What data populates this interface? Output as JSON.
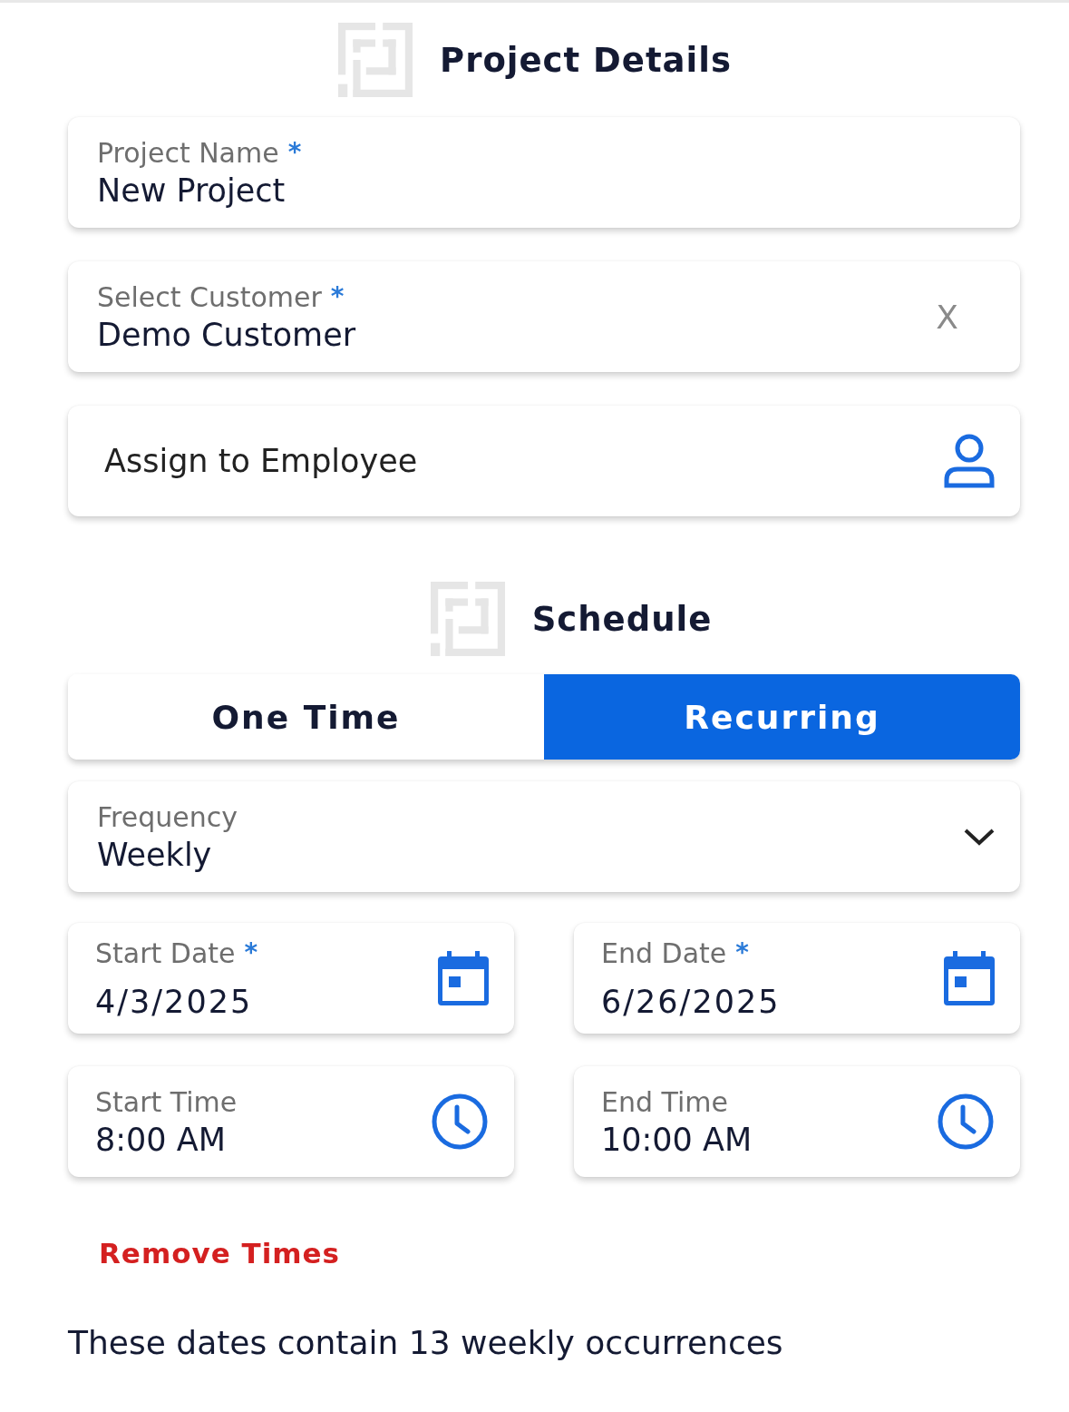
{
  "project_details": {
    "title": "Project Details",
    "fields": [
      {
        "kind": "text",
        "label": "Project Name",
        "required_mark": "*",
        "value": "New Project"
      },
      {
        "kind": "clearable",
        "label": "Select Customer",
        "required_mark": "*",
        "value": "Demo Customer",
        "clear_icon": "X"
      },
      {
        "kind": "picker",
        "placeholder": "Assign to Employee"
      }
    ]
  },
  "schedule": {
    "title": "Schedule",
    "tabs": [
      {
        "label": "One Time",
        "selected": false
      },
      {
        "label": "Recurring",
        "selected": true
      }
    ],
    "frequency": {
      "label": "Frequency",
      "value": "Weekly"
    },
    "pickers": [
      {
        "kind": "date",
        "label": "Start Date",
        "required_mark": "*",
        "value": "4/3/2025"
      },
      {
        "kind": "date",
        "label": "End Date",
        "required_mark": "*",
        "value": "6/26/2025"
      },
      {
        "kind": "time",
        "label": "Start Time",
        "value": "8:00 AM"
      },
      {
        "kind": "time",
        "label": "End Time",
        "value": "10:00 AM"
      }
    ],
    "remove_link": "Remove Times",
    "summary": "These dates contain 13 weekly occurrences"
  }
}
